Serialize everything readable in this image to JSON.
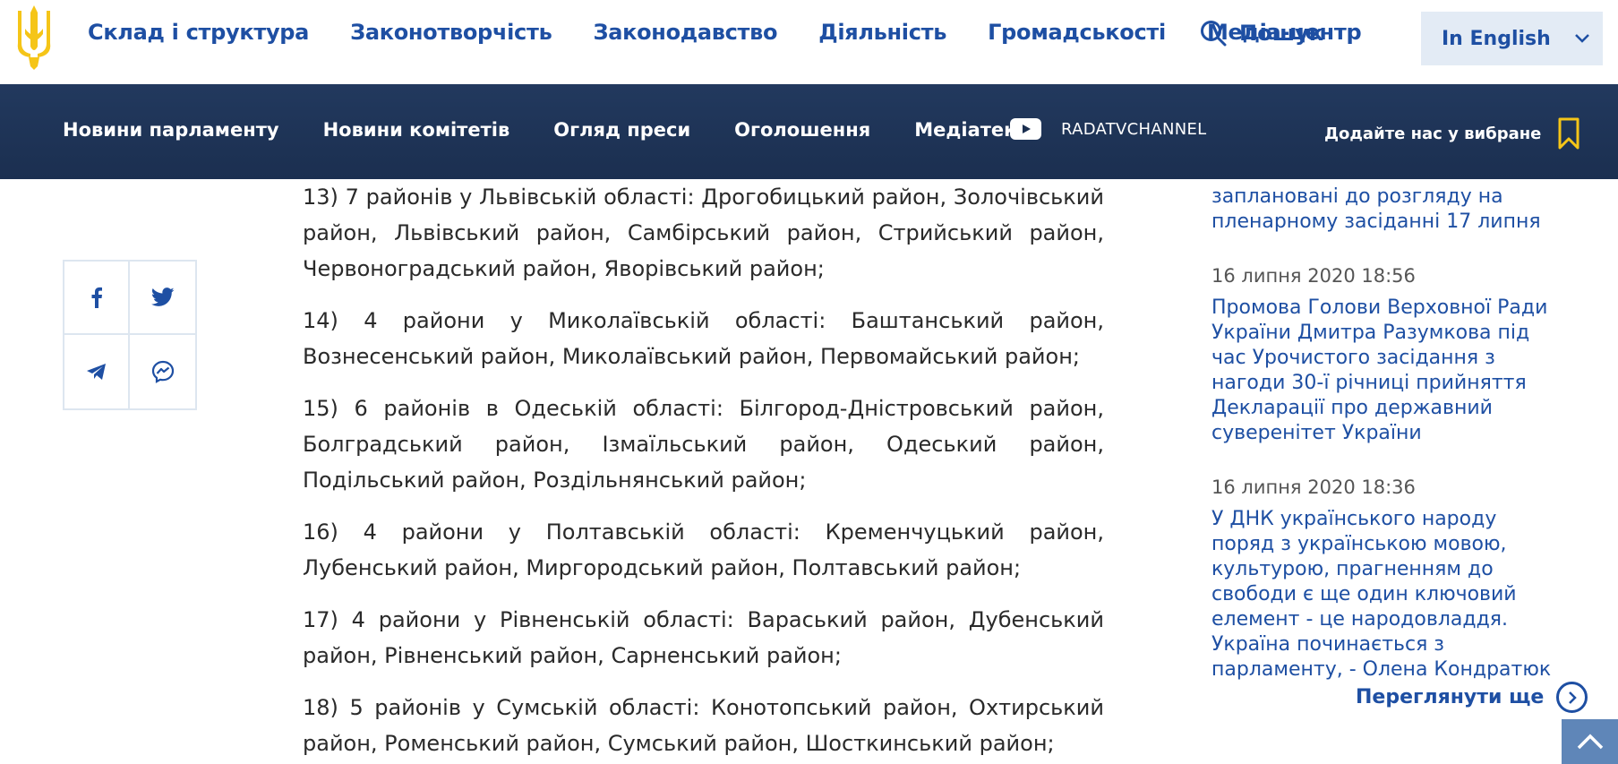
{
  "header": {
    "nav": [
      "Склад і структура",
      "Законотворчість",
      "Законодавство",
      "Діяльність",
      "Громадськості",
      "Медіа-центр"
    ],
    "search_label": "Пошук",
    "language_label": "In English"
  },
  "subheader": {
    "nav": [
      "Новини парламенту",
      "Новини комітетів",
      "Огляд преси",
      "Оголошення",
      "Медіатека"
    ],
    "channel_label": "RADATVCHANNEL",
    "favorites_label": "Додайте нас у вибране"
  },
  "share": {
    "icons": [
      "facebook-icon",
      "twitter-icon",
      "telegram-icon",
      "messenger-icon"
    ]
  },
  "article": {
    "paragraphs": [
      "13) 7 районів у Львівській області: Дрогобицький район, Золочівський район, Львівський район, Самбірський район, Стрийський район, Червоноградський район, Яворівський район;",
      "14) 4 райони у Миколаївській області: Баштанський район, Вознесенський район, Миколаївський район, Первомайський район;",
      "15) 6 районів в Одеській області: Білгород-Дністровський район, Болградський район, Ізмаїльський район, Одеський район, Подільський район, Роздільнянський район;",
      "16) 4 райони у Полтавській області: Кременчуцький район, Лубенський район, Миргородський район, Полтавський район;",
      "17) 4 райони у Рівненській області: Вараський район, Дубенський район, Рівненський район, Сарненський район;",
      "18) 5 районів у Сумській області: Конотопський район, Охтирський район, Роменський район, Сумський район, Шосткинський район;"
    ]
  },
  "sidebar": {
    "partial_item": "заплановані до розгляду на пленарному засіданні 17 липня",
    "news": [
      {
        "date": "16 липня 2020 18:56",
        "title": "Промова Голови Верховної Ради України Дмитра Разумкова під час Урочистого засідання з нагоди 30-ї річниці прийняття Декларації про державний суверенітет України"
      },
      {
        "date": "16 липня 2020 18:36",
        "title": "У ДНК українського народу поряд з українською мовою, культурою, прагненням до свободи є ще один ключовий елемент - це народовладдя. Україна починається з парламенту, - Олена Кондратюк"
      }
    ],
    "more_label": "Переглянути ще"
  },
  "colors": {
    "link_blue": "#1e4fa3",
    "navbar_bg": "#22395e",
    "trident_gold": "#f5c518",
    "lang_bg": "#e3ebf5"
  }
}
